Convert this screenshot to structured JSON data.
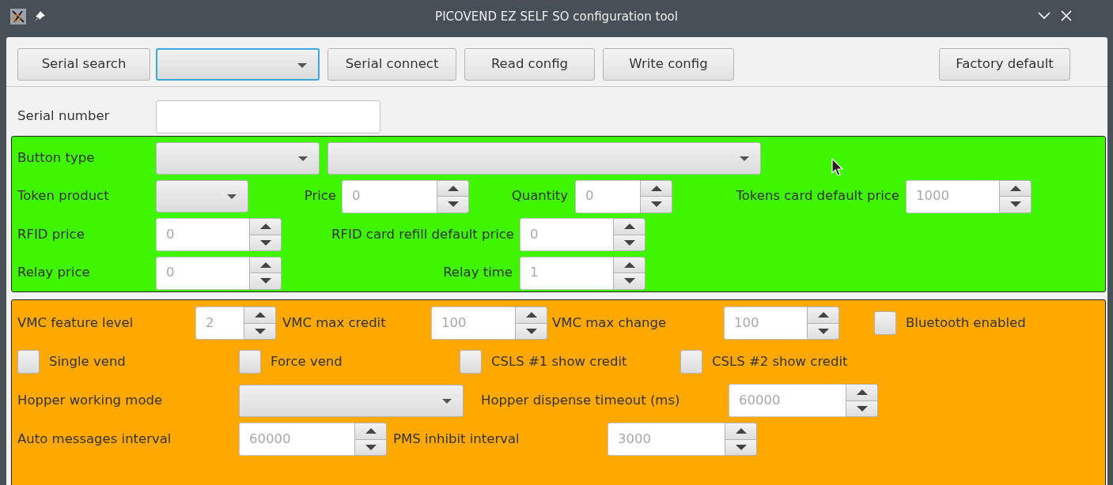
{
  "window": {
    "title": "PICOVEND EZ SELF SO configuration tool"
  },
  "toolbar": [
    {
      "kind": "button",
      "label": "Serial search"
    },
    {
      "kind": "dropdown",
      "focused": true
    },
    {
      "kind": "button",
      "label": "Serial connect"
    },
    {
      "kind": "button",
      "label": "Read config"
    },
    {
      "kind": "button",
      "label": "Write config"
    },
    {
      "kind": "button",
      "label": "Factory default"
    }
  ],
  "serial_number": {
    "label": "Serial number"
  },
  "panels": [
    {
      "color": "#3ff600",
      "fields": [
        {
          "kind": "dropdown",
          "label": "Button type",
          "focused": false
        },
        {
          "kind": "dropdown",
          "focused": false
        },
        {
          "kind": "dropdown",
          "label": "Token product",
          "focused": false
        },
        {
          "kind": "spinner",
          "label": "Price",
          "value": "0"
        },
        {
          "kind": "spinner",
          "label": "Quantity",
          "value": "0"
        },
        {
          "kind": "spinner",
          "label": "Tokens card default price",
          "value": "1000"
        },
        {
          "kind": "spinner",
          "label": "RFID price",
          "value": "0"
        },
        {
          "kind": "spinner",
          "label": "RFID card refill default price",
          "value": "0"
        },
        {
          "kind": "spinner",
          "label": "Relay price",
          "value": "0"
        },
        {
          "kind": "spinner",
          "label": "Relay time",
          "value": "1"
        }
      ]
    },
    {
      "color": "#ffa800",
      "fields": [
        {
          "kind": "spinner",
          "label": "VMC feature level",
          "value": "2"
        },
        {
          "kind": "spinner",
          "label": "VMC max credit",
          "value": "100"
        },
        {
          "kind": "spinner",
          "label": "VMC max change",
          "value": "100"
        },
        {
          "kind": "checkbox",
          "label": "Bluetooth enabled",
          "checked": false
        },
        {
          "kind": "checkbox",
          "label": "Single vend",
          "checked": false
        },
        {
          "kind": "checkbox",
          "label": "Force vend",
          "checked": false
        },
        {
          "kind": "checkbox",
          "label": "CSLS #1 show credit",
          "checked": false
        },
        {
          "kind": "checkbox",
          "label": "CSLS #2 show credit",
          "checked": false
        },
        {
          "kind": "dropdown",
          "label": "Hopper working mode",
          "focused": false
        },
        {
          "kind": "spinner",
          "label": "Hopper dispense timeout (ms)",
          "value": "60000"
        },
        {
          "kind": "spinner",
          "label": "Auto messages interval",
          "value": "60000"
        },
        {
          "kind": "spinner",
          "label": "PMS inhibit interval",
          "value": "3000"
        }
      ]
    }
  ]
}
